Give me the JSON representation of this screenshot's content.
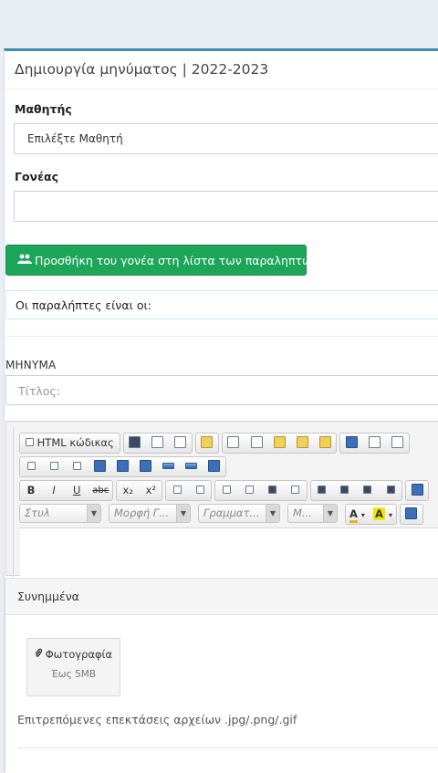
{
  "panel": {
    "title": "Δημιουργία μηνύματος | 2022-2023"
  },
  "student": {
    "label": "Μαθητής",
    "value": "Επιλέξτε Μαθητή"
  },
  "parent": {
    "label": "Γονέας",
    "value": ""
  },
  "add_parent_button": {
    "icon": "users-icon",
    "label": "Προσθήκη του γονέα στη λίστα των παραληπτών"
  },
  "recipients": {
    "text": "Οι παραλήπτες είναι οι:"
  },
  "message": {
    "label": "ΜΗΝΥΜΑ",
    "title_placeholder": "Τίτλος:"
  },
  "editor": {
    "source_label": "HTML κώδικας",
    "styles_combo": "Στυλ",
    "format_combo": "Μορφή Γ...",
    "font_combo": "Γραμματ...",
    "size_combo": "Μ...",
    "bold": "B",
    "italic": "I",
    "underline": "U",
    "strike": "abc",
    "subscript": "x₂",
    "superscript": "x²",
    "text_color": "A",
    "bg_color": "A",
    "colors": {
      "accent_yellow": "#f5e700",
      "toolbar_border": "#c6c6c6"
    }
  },
  "attachments": {
    "header": "Συνημμένα",
    "photo_icon": "paperclip-icon",
    "photo_label": "Φωτογραφία",
    "photo_limit": "Έως 5MB",
    "allowed_text": "Επιτρεπόμενες επεκτάσεις αρχείων .jpg/.png/.gif"
  },
  "colors": {
    "primary": "#3c8dbc",
    "success": "#1da55a"
  }
}
